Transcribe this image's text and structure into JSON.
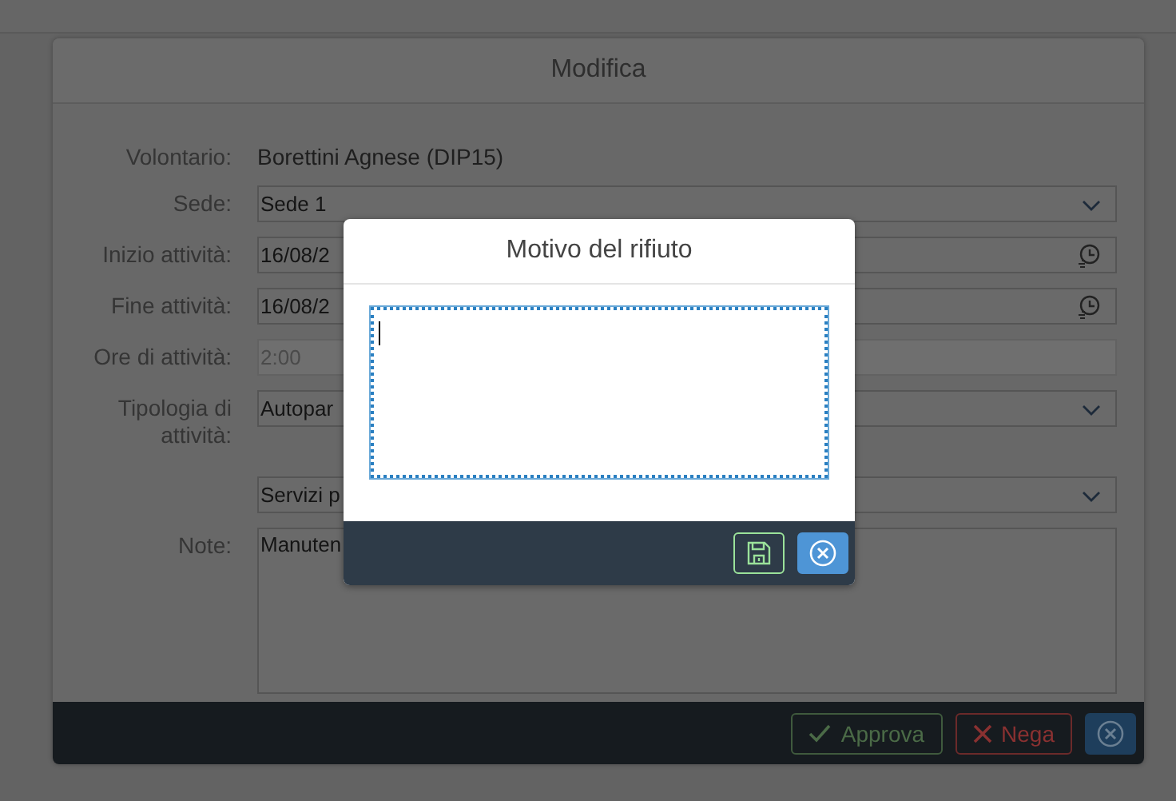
{
  "dialog": {
    "title": "Modifica",
    "fields": [
      {
        "kind": "text",
        "label": "Volontario:",
        "value": "Borettini Agnese (DIP15)",
        "disabled": false
      },
      {
        "kind": "select",
        "label": "Sede:",
        "value": "Sede 1",
        "disabled": false
      },
      {
        "kind": "datetime",
        "label": "Inizio attività:",
        "value": "16/08/2",
        "disabled": false
      },
      {
        "kind": "datetime",
        "label": "Fine attività:",
        "value": "16/08/2",
        "disabled": false
      },
      {
        "kind": "input",
        "label": "Ore di attività:",
        "value": "2:00",
        "disabled": true
      },
      {
        "kind": "select",
        "label": "Tipologia di attività:",
        "value": "Autopar",
        "disabled": false
      },
      {
        "kind": "select",
        "value": "Servizi p",
        "disabled": false
      },
      {
        "kind": "textarea",
        "label": "Note:",
        "value": "Manuten",
        "disabled": false
      }
    ],
    "buttons": [
      {
        "kind": "approve",
        "label": "Approva"
      },
      {
        "kind": "deny",
        "label": "Nega"
      },
      {
        "kind": "close"
      }
    ]
  },
  "popup": {
    "title": "Motivo del rifiuto",
    "buttons": [
      {
        "kind": "save"
      },
      {
        "kind": "close"
      }
    ]
  }
}
